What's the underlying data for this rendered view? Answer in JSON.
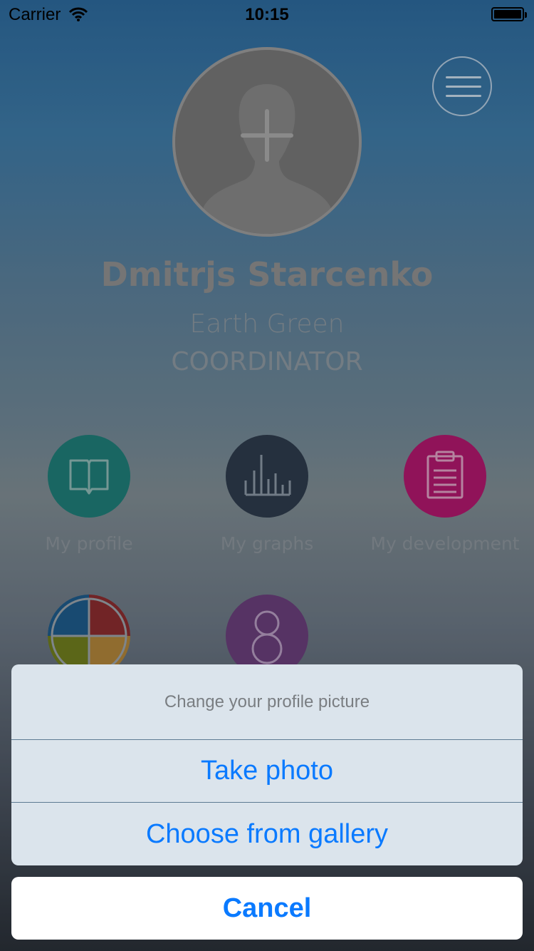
{
  "status_bar": {
    "carrier": "Carrier",
    "time": "10:15",
    "icons": [
      "wifi-icon",
      "battery-icon"
    ]
  },
  "profile": {
    "name": "Dmitrjs Starcenko",
    "organization": "Earth Green",
    "role": "COORDINATOR",
    "avatar_icon": "add-photo-icon"
  },
  "menu": {
    "icon": "hamburger-menu-icon"
  },
  "tiles": [
    {
      "label": "My profile",
      "icon": "book-icon",
      "color": "#1f7d78"
    },
    {
      "label": "My graphs",
      "icon": "bar-chart-icon",
      "color": "#2e3b4c"
    },
    {
      "label": "My development",
      "icon": "clipboard-icon",
      "color": "#b0186d"
    },
    {
      "label": "",
      "icon": "quadrant-icon",
      "color": "#444"
    },
    {
      "label": "",
      "icon": "number-eight-icon",
      "color": "#6a3f7a"
    }
  ],
  "action_sheet": {
    "title": "Change your profile picture",
    "options": [
      "Take photo",
      "Choose from gallery"
    ],
    "cancel": "Cancel"
  },
  "colors": {
    "accent": "#0a7aff",
    "sheet_bg": "#dbe4ec"
  }
}
